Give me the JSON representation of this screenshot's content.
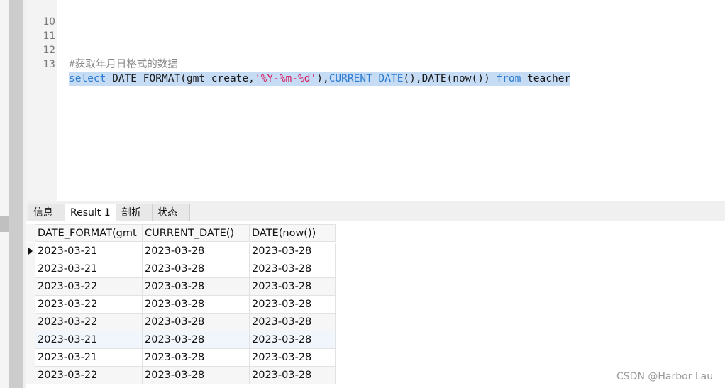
{
  "editor": {
    "lines": [
      {
        "num": "10",
        "text": ""
      },
      {
        "num": "11",
        "text": ""
      },
      {
        "num": "12",
        "comment": "#获取年月日格式的数据"
      },
      {
        "num": "13",
        "kw_select": "select",
        "fn_date_format": " DATE_FORMAT(gmt_create,",
        "str_format": "'%Y-%m-%d'",
        "comma1": "),",
        "fn_current_date": "CURRENT_DATE",
        "paren1": "(),DATE(now()) ",
        "kw_from": "from",
        "table": " teacher"
      }
    ]
  },
  "tabs": [
    {
      "label": "信息"
    },
    {
      "label": "Result 1"
    },
    {
      "label": "剖析"
    },
    {
      "label": "状态"
    }
  ],
  "grid": {
    "columns": [
      "DATE_FORMAT(gmt",
      "CURRENT_DATE()",
      "DATE(now())"
    ],
    "rows": [
      [
        "2023-03-21",
        "2023-03-28",
        "2023-03-28"
      ],
      [
        "2023-03-21",
        "2023-03-28",
        "2023-03-28"
      ],
      [
        "2023-03-22",
        "2023-03-28",
        "2023-03-28"
      ],
      [
        "2023-03-22",
        "2023-03-28",
        "2023-03-28"
      ],
      [
        "2023-03-22",
        "2023-03-28",
        "2023-03-28"
      ],
      [
        "2023-03-21",
        "2023-03-28",
        "2023-03-28"
      ],
      [
        "2023-03-21",
        "2023-03-28",
        "2023-03-28"
      ],
      [
        "2023-03-22",
        "2023-03-28",
        "2023-03-28"
      ]
    ]
  },
  "watermark": "CSDN @Harbor Lau",
  "colors": {
    "keyword": "#2a7ad0",
    "string": "#d81b60",
    "selection": "#c6dcf5"
  }
}
